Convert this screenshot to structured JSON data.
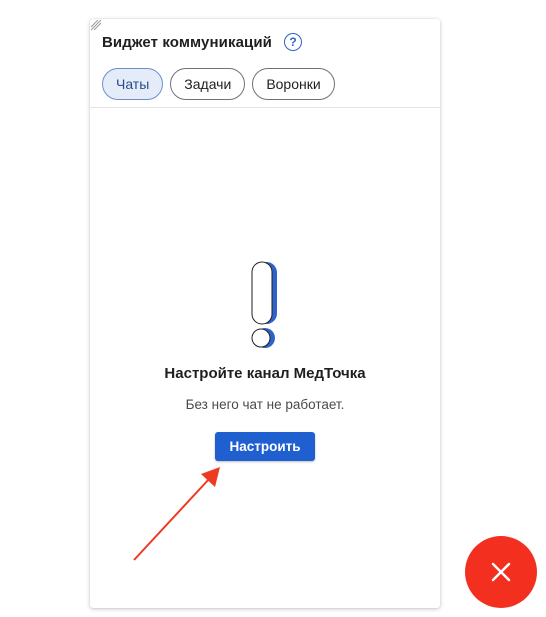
{
  "widget": {
    "title": "Виджет коммуникаций",
    "help_glyph": "?",
    "tabs": [
      {
        "label": "Чаты",
        "active": true
      },
      {
        "label": "Задачи",
        "active": false
      },
      {
        "label": "Воронки",
        "active": false
      }
    ]
  },
  "empty_state": {
    "icon": "exclamation-icon",
    "title": "Настройте канал МедТочка",
    "subtitle": "Без него чат не работает.",
    "button_label": "Настроить"
  },
  "fab": {
    "icon": "close-icon",
    "color": "#f3301f"
  },
  "colors": {
    "accent": "#1f5fcf",
    "annotation_arrow": "#ef3a23"
  }
}
